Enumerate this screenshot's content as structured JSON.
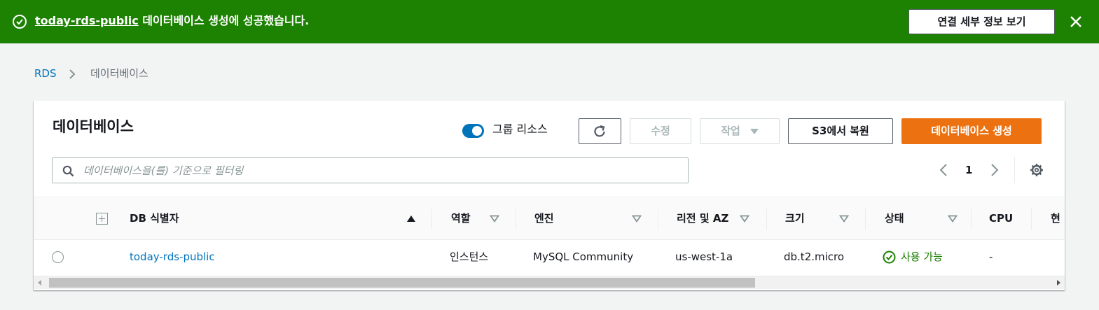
{
  "banner": {
    "db_name": "today-rds-public",
    "message_suffix": " 데이터베이스 생성에 성공했습니다.",
    "details_button": "연결 세부 정보 보기",
    "close_icon": "close-icon",
    "status_icon": "check-circle-icon",
    "bg_color": "#1d8102"
  },
  "breadcrumb": {
    "root": "RDS",
    "current": "데이터베이스"
  },
  "panel": {
    "title": "데이터베이스",
    "group_resources_label": "그룹 리소스",
    "group_resources_on": true,
    "refresh_icon": "refresh-icon",
    "edit_label": "수정",
    "actions_label": "작업",
    "restore_s3_label": "S3에서 복원",
    "create_label": "데이터베이스 생성",
    "accent_color": "#ec7211",
    "search": {
      "placeholder": "데이터베이스을(를) 기준으로 필터링",
      "value": ""
    },
    "pagination": {
      "current_page": "1"
    }
  },
  "table": {
    "columns": [
      {
        "label": "DB 식별자",
        "sort": "asc"
      },
      {
        "label": "역할",
        "sort": "none"
      },
      {
        "label": "엔진",
        "sort": "none"
      },
      {
        "label": "리전 및 AZ",
        "sort": "none"
      },
      {
        "label": "크기",
        "sort": "none"
      },
      {
        "label": "상태",
        "sort": "none"
      },
      {
        "label": "CPU",
        "sort": "none"
      },
      {
        "label": "현",
        "sort": "none"
      }
    ],
    "rows": [
      {
        "selected": false,
        "identifier": "today-rds-public",
        "role": "인스턴스",
        "engine": "MySQL Community",
        "region_az": "us-west-1a",
        "size": "db.t2.micro",
        "status": "사용 가능",
        "status_color": "#1d8102",
        "cpu": "-"
      }
    ]
  }
}
